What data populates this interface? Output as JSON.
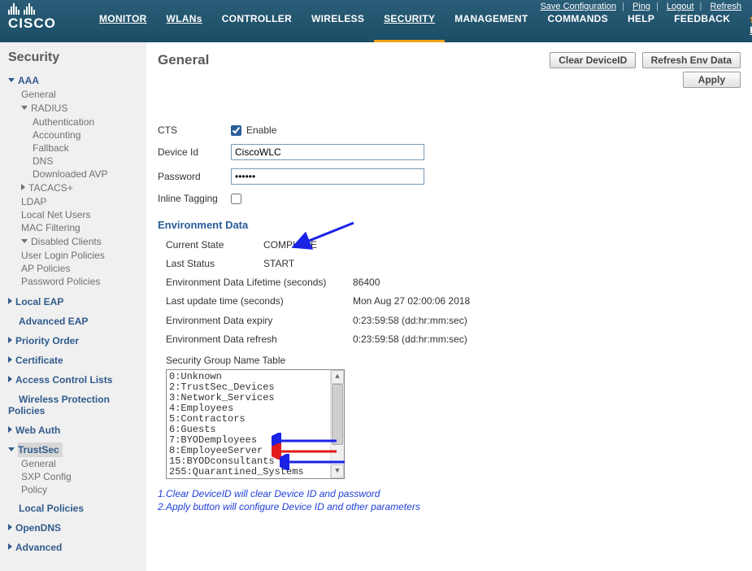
{
  "top_links": {
    "save": "Save Configuration",
    "ping": "Ping",
    "logout": "Logout",
    "refresh": "Refresh"
  },
  "logo": "CISCO",
  "nav": {
    "monitor": "MONITOR",
    "wlans": "WLANs",
    "controller": "CONTROLLER",
    "wireless": "WIRELESS",
    "security": "SECURITY",
    "management": "MANAGEMENT",
    "commands": "COMMANDS",
    "help": "HELP",
    "feedback": "FEEDBACK",
    "home": "Home"
  },
  "sidebar": {
    "title": "Security",
    "aaa": "AAA",
    "aaa_general": "General",
    "radius": "RADIUS",
    "radius_auth": "Authentication",
    "radius_acct": "Accounting",
    "radius_fallback": "Fallback",
    "radius_dns": "DNS",
    "radius_dlavp": "Downloaded AVP",
    "tacacs": "TACACS+",
    "ldap": "LDAP",
    "localnet": "Local Net Users",
    "macfilter": "MAC Filtering",
    "disabled": "Disabled Clients",
    "userlogin": "User Login Policies",
    "appol": "AP Policies",
    "pwdpol": "Password Policies",
    "localeap": "Local EAP",
    "adveap": "Advanced EAP",
    "priorder": "Priority Order",
    "cert": "Certificate",
    "acl": "Access Control Lists",
    "wpp": "Wireless Protection Policies",
    "webauth": "Web Auth",
    "trustsec": "TrustSec",
    "ts_general": "General",
    "ts_sxp": "SXP Config",
    "ts_policy": "Policy",
    "localpol": "Local Policies",
    "opendns": "OpenDNS",
    "advanced": "Advanced"
  },
  "page": {
    "title": "General",
    "btn_clear": "Clear DeviceID",
    "btn_refresh": "Refresh Env Data",
    "btn_apply": "Apply"
  },
  "form": {
    "cts_label": "CTS",
    "cts_checked": true,
    "cts_enable": "Enable",
    "devid_label": "Device Id",
    "devid_value": "CiscoWLC",
    "pwd_label": "Password",
    "pwd_value": "••••••",
    "inline_label": "Inline Tagging",
    "inline_checked": false
  },
  "env": {
    "heading": "Environment Data",
    "current_state_l": "Current State",
    "current_state_v": "COMPLETE",
    "last_status_l": "Last Status",
    "last_status_v": "START",
    "lifetime_l": "Environment Data Lifetime (seconds)",
    "lifetime_v": "86400",
    "lastupd_l": "Last update time (seconds)",
    "lastupd_v": "Mon Aug 27 02:00:06 2018",
    "expiry_l": "Environment Data expiry",
    "expiry_v": "0:23:59:58 (dd:hr:mm:sec)",
    "refresh_l": "Environment Data refresh",
    "refresh_v": "0:23:59:58 (dd:hr:mm:sec)",
    "sgt_label": "Security Group Name Table",
    "sgt": [
      "0:Unknown",
      "2:TrustSec_Devices",
      "3:Network_Services",
      "4:Employees",
      "5:Contractors",
      "6:Guests",
      "7:BYODemployees",
      "8:EmployeeServer",
      "15:BYODconsultants",
      "255:Quarantined_Systems"
    ]
  },
  "notes": {
    "l1": "1.Clear DeviceID will clear Device ID and password",
    "l2": "2.Apply button will configure Device ID and other parameters"
  }
}
